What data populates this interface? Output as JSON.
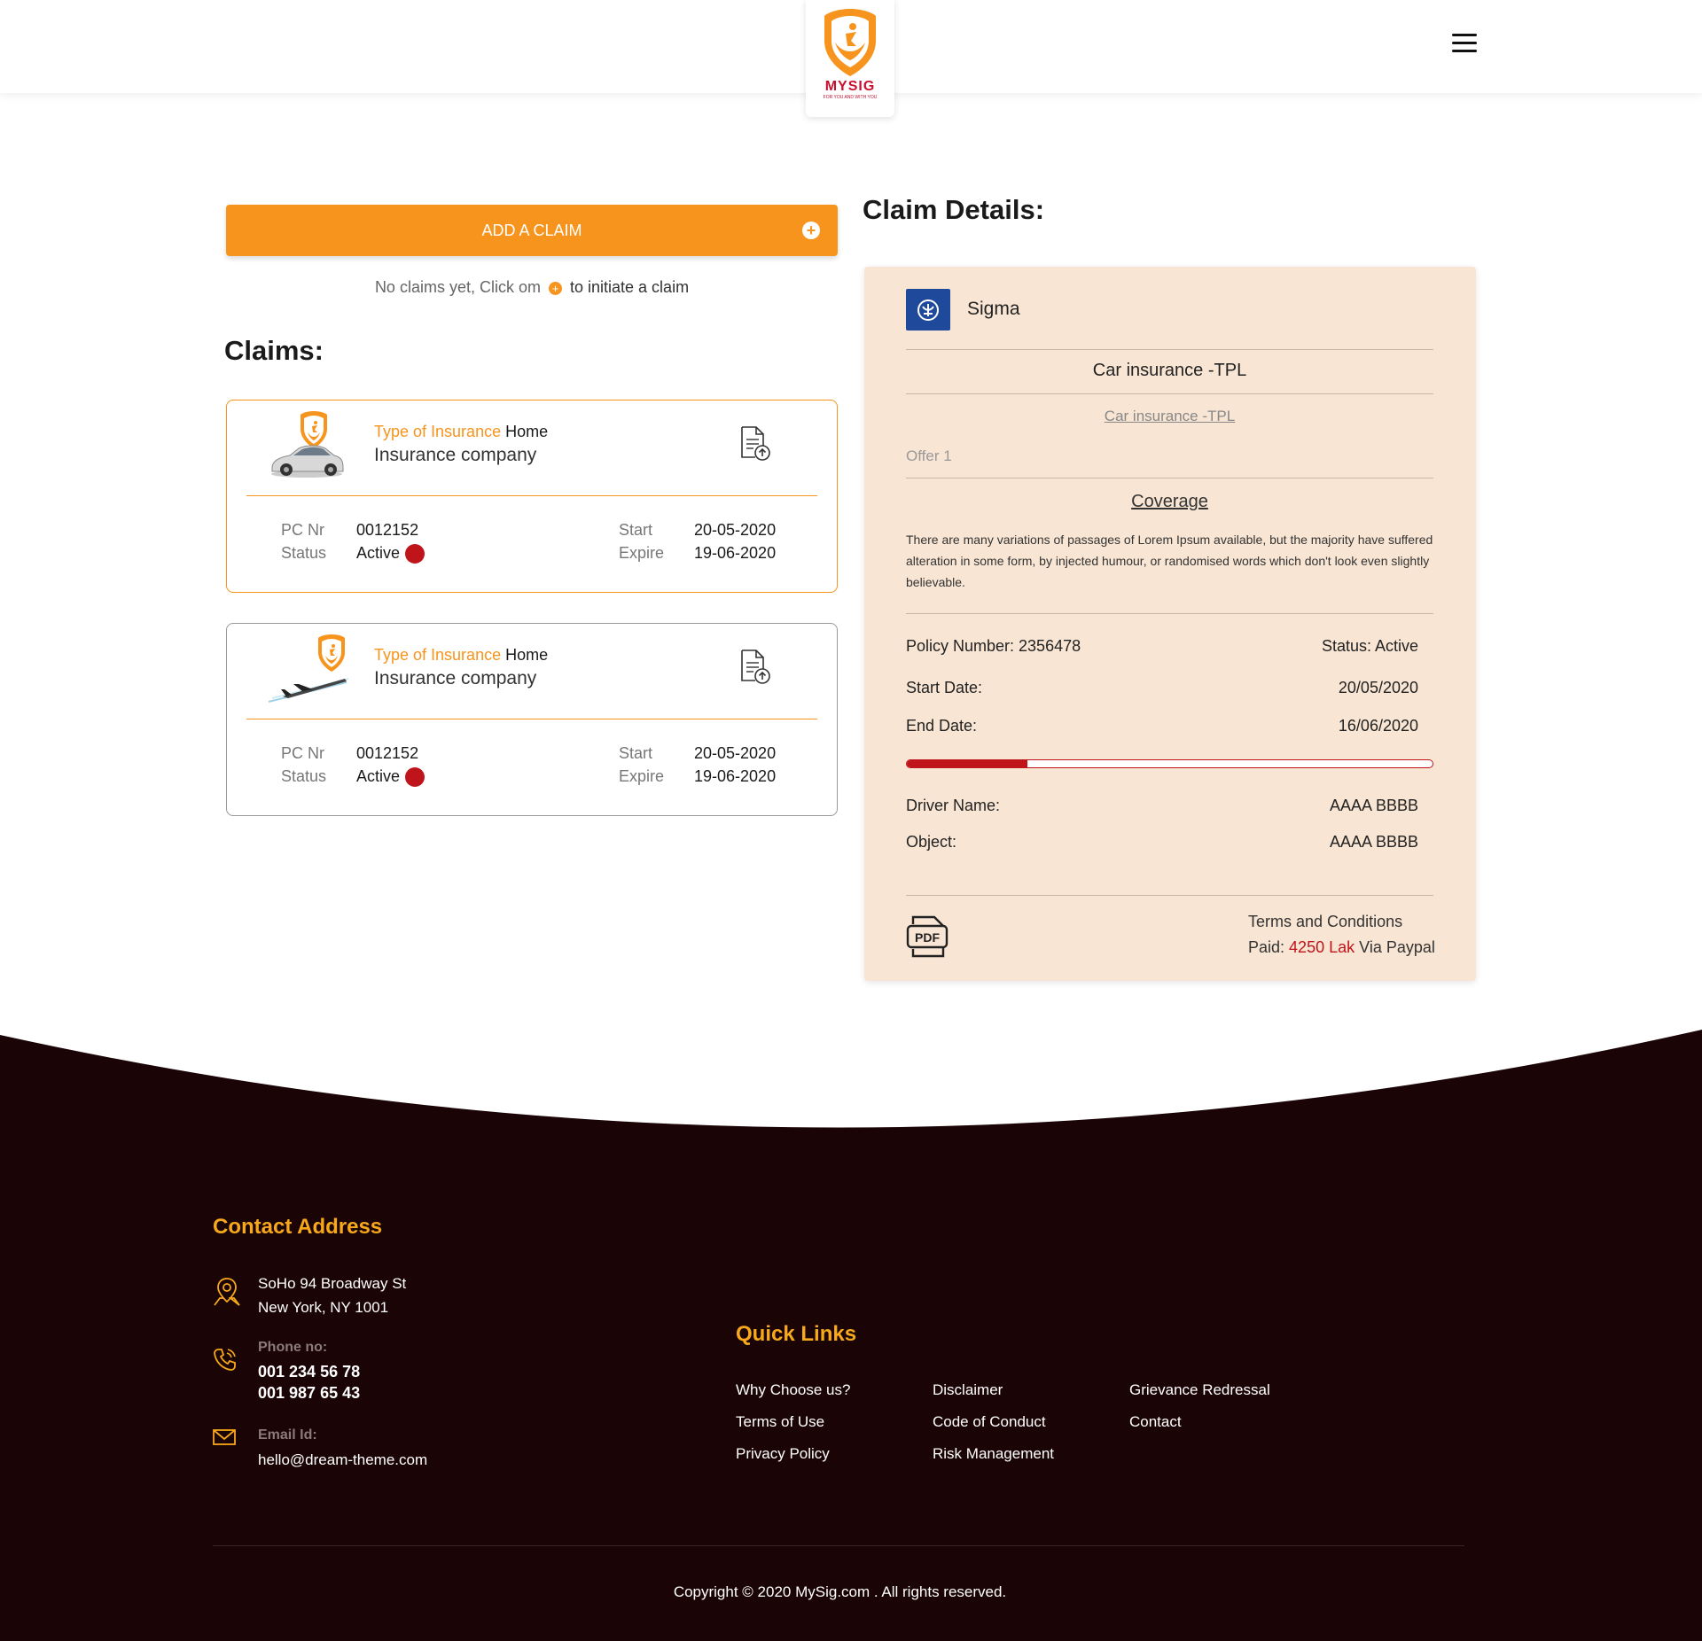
{
  "header": {
    "logo_text": "MYSIG",
    "logo_tagline": "FOR YOU AND WITH YOU"
  },
  "claims_panel": {
    "add_claim_label": "ADD A CLAIM",
    "no_claims_text_1": "No claims yet, Click om",
    "no_claims_text_2": "to initiate a claim",
    "claims_title": "Claims:"
  },
  "claims": [
    {
      "type_label": "Type of Insurance",
      "type_value": "Home",
      "company": "Insurance company",
      "pc_label": "PC Nr",
      "pc_value": "0012152",
      "status_label": "Status",
      "status_value": "Active",
      "start_label": "Start",
      "start_value": "20-05-2020",
      "expire_label": "Expire",
      "expire_value": "19-06-2020",
      "thumb_icon": "car-icon"
    },
    {
      "type_label": "Type of Insurance",
      "type_value": "Home",
      "company": "Insurance company",
      "pc_label": "PC Nr",
      "pc_value": "0012152",
      "status_label": "Status",
      "status_value": "Active",
      "start_label": "Start",
      "start_value": "20-05-2020",
      "expire_label": "Expire",
      "expire_value": "19-06-2020",
      "thumb_icon": "airplane-icon"
    }
  ],
  "details": {
    "title": "Claim Details:",
    "company": "Sigma",
    "product": "Car insurance -TPL",
    "product_link": "Car insurance -TPL",
    "offer": "Offer 1",
    "coverage_title": "Coverage",
    "coverage_text": "There are many variations of passages of Lorem Ipsum available, but the majority have suffered alteration in some form, by injected humour, or randomised words which don't look even slightly believable.",
    "policy_number": "Policy Number: 2356478",
    "status": "Status: Active",
    "start_label": "Start Date:",
    "start_value": "20/05/2020",
    "end_label": "End Date:",
    "end_value": "16/06/2020",
    "progress_fraction": 0.23,
    "driver_label": "Driver Name:",
    "driver_value": "AAAA BBBB",
    "object_label": "Object:",
    "object_value": "AAAA BBBB",
    "terms": "Terms and Conditions",
    "paid_label": "Paid:",
    "paid_amount": "4250 Lak",
    "paid_via": "Via Paypal",
    "pdf_icon_text": "PDF"
  },
  "footer": {
    "contact_title": "Contact Address",
    "address_line1": "SoHo 94 Broadway St",
    "address_line2": "New York, NY 1001",
    "phone_label": "Phone no:",
    "phone1": "001 234 56 78",
    "phone2": "001 987 65 43",
    "email_label": "Email Id:",
    "email": "hello@dream-theme.com",
    "quick_links_title": "Quick Links",
    "links": [
      "Why Choose us?",
      "Disclaimer",
      "Grievance Redressal",
      "Terms of Use",
      "Code of Conduct",
      "Contact",
      "Privacy Policy",
      "Risk Management"
    ],
    "copyright": "Copyright © 2020 MySig.com . All rights reserved."
  },
  "colors": {
    "accent": "#f7941d",
    "danger": "#c0141b",
    "footer_bg": "#1a0406",
    "details_bg": "#f8e5d3"
  }
}
